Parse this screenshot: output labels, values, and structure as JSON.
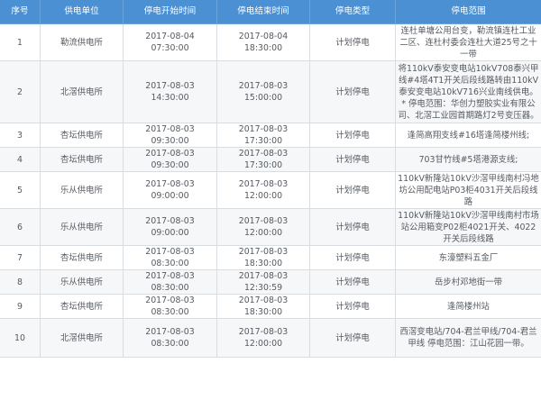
{
  "table": {
    "headers": [
      "序号",
      "供电单位",
      "停电开始时间",
      "停电结束时间",
      "停电类型",
      "停电范围"
    ],
    "rows": [
      {
        "no": "1",
        "unit": "勒流供电所",
        "start": "2017-08-04 07:30:00",
        "end": "2017-08-04 18:30:00",
        "type": "计划停电",
        "range": "连杜单塘公用台变，勒流镇连杜工业二区、连杜村委会连杜大道25号之十一带"
      },
      {
        "no": "2",
        "unit": "北滘供电所",
        "start": "2017-08-03 14:30:00",
        "end": "2017-08-03 15:00:00",
        "type": "计划停电",
        "range": "将110kV泰安变电站10kV708泰兴甲线#4塔4T1开关后段线路转由110kV泰安变电站10kV716兴业南线供电。 * 停电范围：华创力塑胶实业有限公司、北滘工业园首期路灯2号变压器。"
      },
      {
        "no": "3",
        "unit": "杏坛供电所",
        "start": "2017-08-03 09:30:00",
        "end": "2017-08-03 17:30:00",
        "type": "计划停电",
        "range": "逢简高翔支线#16塔逢简楼州线;"
      },
      {
        "no": "4",
        "unit": "杏坛供电所",
        "start": "2017-08-03 09:30:00",
        "end": "2017-08-03 17:30:00",
        "type": "计划停电",
        "range": "703甘竹线#5塔港源支线;"
      },
      {
        "no": "5",
        "unit": "乐从供电所",
        "start": "2017-08-03 09:00:00",
        "end": "2017-08-03 12:00:00",
        "type": "计划停电",
        "range": "110kV新隆站10kV沙滘甲线南村冯地坊公用配电站P03柜4031开关后段线路"
      },
      {
        "no": "6",
        "unit": "乐从供电所",
        "start": "2017-08-03 09:00:00",
        "end": "2017-08-03 12:00:00",
        "type": "计划停电",
        "range": "110kV新隆站10kV沙滘甲线南村市场站公用箱变P02柜4021开关、4022开关后段线路"
      },
      {
        "no": "7",
        "unit": "杏坛供电所",
        "start": "2017-08-03 08:30:00",
        "end": "2017-08-03 18:30:00",
        "type": "计划停电",
        "range": "东濠塑料五金厂"
      },
      {
        "no": "8",
        "unit": "乐从供电所",
        "start": "2017-08-03 08:30:00",
        "end": "2017-08-03 12:30:59",
        "type": "计划停电",
        "range": "岳步村邓地街一带"
      },
      {
        "no": "9",
        "unit": "杏坛供电所",
        "start": "2017-08-03 08:30:00",
        "end": "2017-08-03 18:30:00",
        "type": "计划停电",
        "range": "逢简楼州站"
      },
      {
        "no": "10",
        "unit": "北滘供电所",
        "start": "2017-08-03 08:30:00",
        "end": "2017-08-03 12:00:00",
        "type": "计划停电",
        "range": "西滘变电站/704-君兰甲线/704-君兰甲线 停电范围：江山花园一带。"
      }
    ]
  }
}
